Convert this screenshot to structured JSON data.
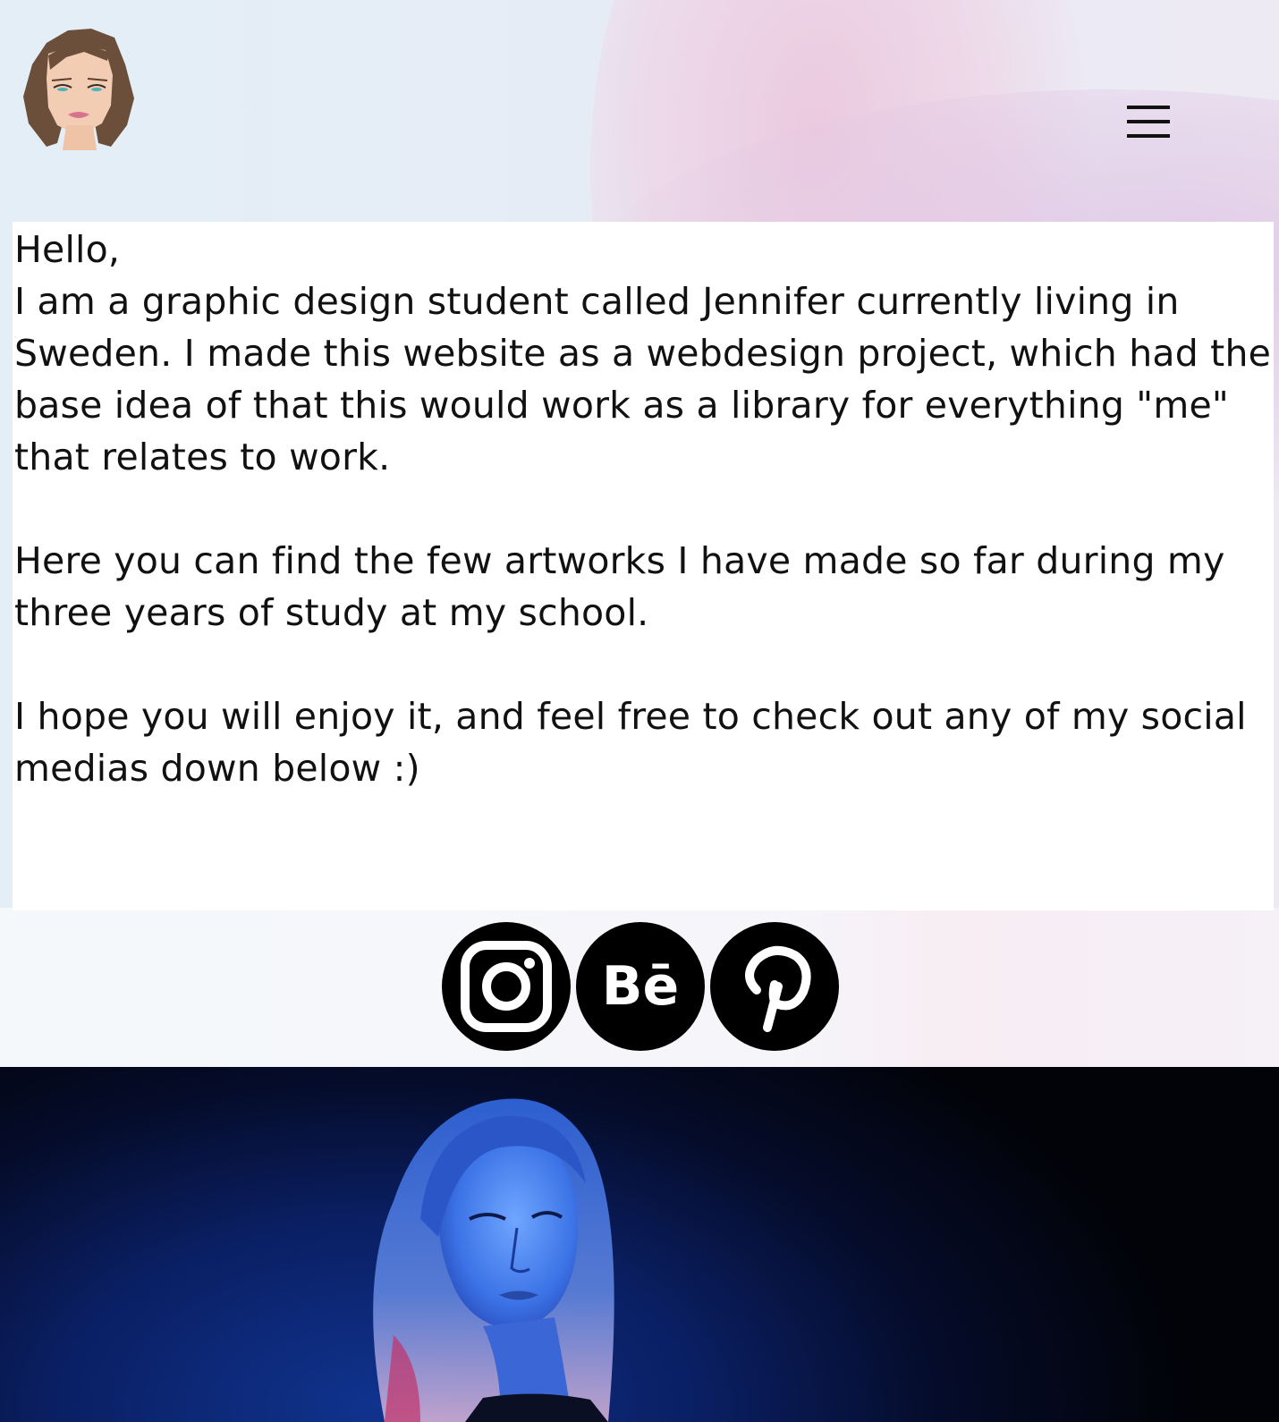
{
  "header": {
    "logo_icon": "woman-avatar-icon",
    "menu_icon": "hamburger-menu-icon"
  },
  "intro": {
    "greeting": "Hello,",
    "paragraph1": "I am a graphic design student called Jennifer currently living in Sweden. I made this website as a webdesign project, which had the base idea of that this would work as a library for everything \"me\" that relates to work.",
    "paragraph2": "Here you can find the few artworks I have made so far during my three years of study at my school.",
    "paragraph3": "I hope you will enjoy it, and feel free to check out any of my social medias down below :)"
  },
  "socials": [
    {
      "icon": "instagram-icon"
    },
    {
      "icon": "behance-icon",
      "glyph": "Bē"
    },
    {
      "icon": "pinterest-icon"
    }
  ],
  "hero": {
    "image": "portrait-photo-blue-light"
  },
  "colors": {
    "text": "#111111",
    "social_bg": "#000000",
    "hero_blue": "#10338e"
  }
}
